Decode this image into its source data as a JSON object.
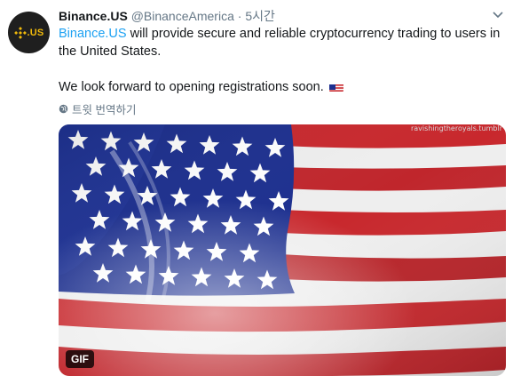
{
  "tweet": {
    "author_name": "Binance.US",
    "handle": "@BinanceAmerica",
    "separator": "·",
    "time": "5시간",
    "body_link": "Binance.US",
    "body_line1_rest": " will provide secure and reliable cryptocurrency trading to users in the United States.",
    "body_line2": "We look forward to opening registrations soon. ",
    "flag_emoji_name": "us-flag-emoji",
    "translate_label": "트윗 번역하기",
    "gif_label": "GIF",
    "watermark": "ravishingtheroyals.tumblr",
    "avatar_logo_text": ".US"
  },
  "colors": {
    "link": "#1da1f2",
    "muted": "#657786",
    "binance_yellow": "#f0b90b",
    "flag_red": "#c8282d",
    "flag_blue": "#1c2f8f"
  }
}
